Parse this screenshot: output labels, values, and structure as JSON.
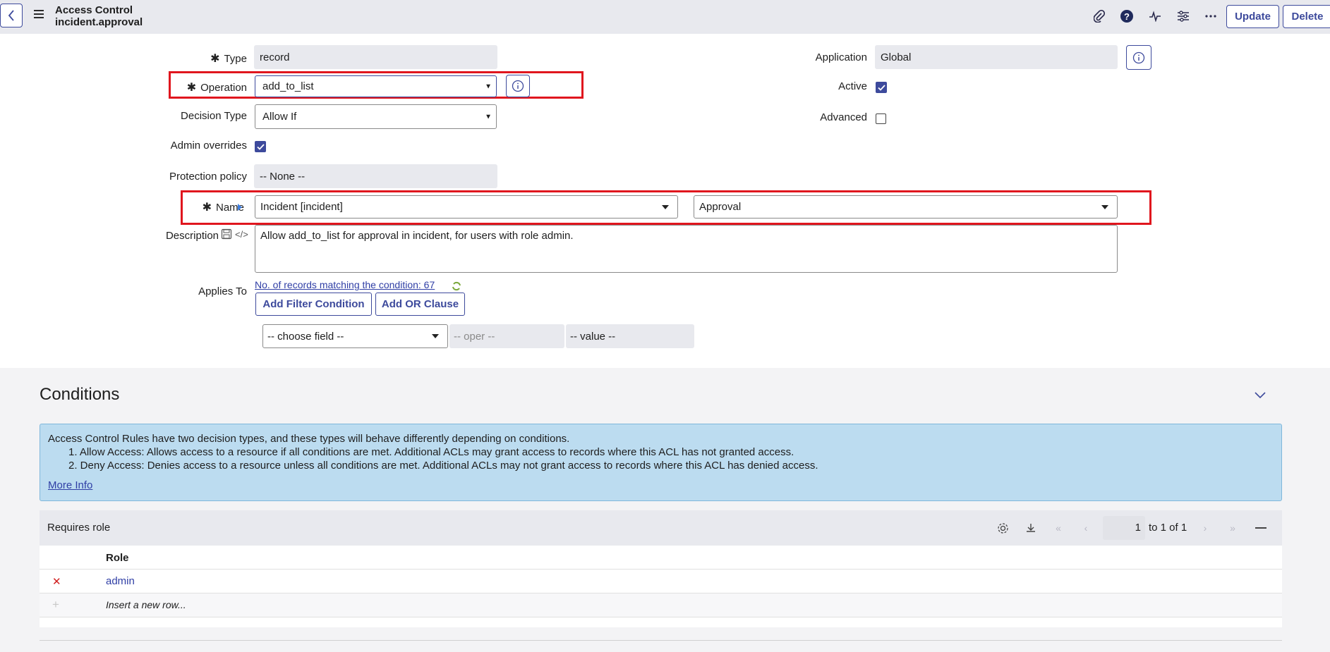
{
  "header": {
    "title_line1": "Access Control",
    "title_line2": "incident.approval",
    "update_label": "Update",
    "delete_label": "Delete"
  },
  "form": {
    "type": {
      "label": "Type",
      "value": "record"
    },
    "operation": {
      "label": "Operation",
      "value": "add_to_list"
    },
    "decision_type": {
      "label": "Decision Type",
      "value": "Allow If"
    },
    "admin_overrides": {
      "label": "Admin overrides",
      "checked": true
    },
    "protection_policy": {
      "label": "Protection policy",
      "value": "-- None --"
    },
    "name": {
      "label": "Name",
      "table_value": "Incident [incident]",
      "field_value": "Approval"
    },
    "description": {
      "label": "Description",
      "value": "Allow add_to_list for approval in incident, for users with role admin."
    },
    "applies_to": {
      "label": "Applies To",
      "records_link": "No. of records matching the condition: 67",
      "add_filter_label": "Add Filter Condition",
      "add_or_label": "Add OR Clause",
      "choose_field": "-- choose field --",
      "oper": "-- oper --",
      "value": "-- value --"
    },
    "application": {
      "label": "Application",
      "value": "Global"
    },
    "active": {
      "label": "Active",
      "checked": true
    },
    "advanced": {
      "label": "Advanced",
      "checked": false
    }
  },
  "conditions": {
    "title": "Conditions",
    "info_intro": "Access Control Rules have two decision types, and these types will behave differently depending on conditions.",
    "info_item1": "1. Allow Access: Allows access to a resource if all conditions are met. Additional ACLs may grant access to records where this ACL has not granted access.",
    "info_item2": "2. Deny Access: Denies access to a resource unless all conditions are met. Additional ACLs may not grant access to records where this ACL has denied access.",
    "more_info": "More Info",
    "requires_role_label": "Requires role",
    "page_input": "1",
    "pagination": "to 1 of 1",
    "role_header": "Role",
    "roles": [
      "admin"
    ],
    "insert_row": "Insert a new row..."
  },
  "colors": {
    "accent": "#3d4a9c",
    "highlight_red": "#e0161e",
    "info_bg": "#bcdcf0"
  }
}
